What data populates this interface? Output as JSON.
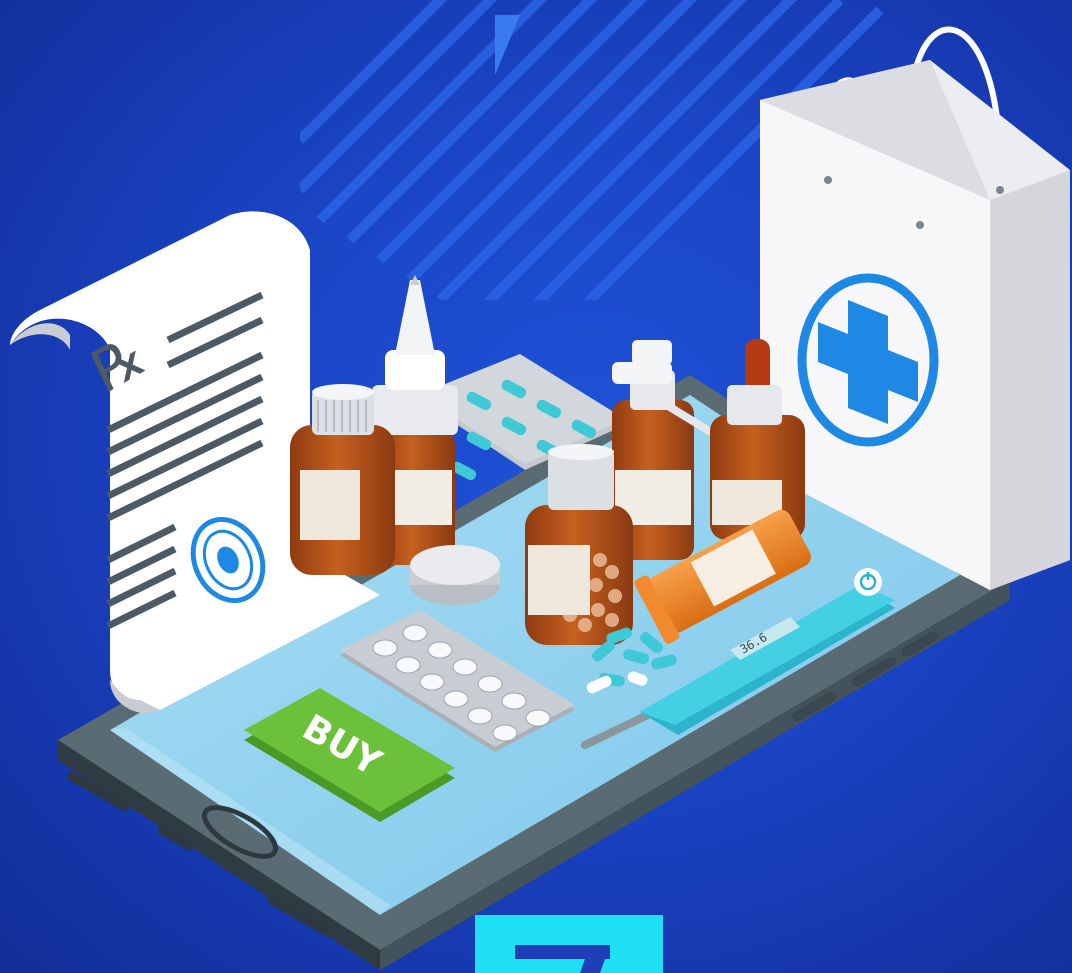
{
  "illustration": {
    "prescription_symbol": "℞",
    "buy_button_label": "BUY",
    "thermometer_reading": "36.6"
  },
  "colors": {
    "background": "#1a44c4",
    "phone_body": "#4f6068",
    "phone_screen": "#8fd0ee",
    "buy_button": "#6cc13a",
    "medical_cross": "#1e88e5",
    "bottle_amber": "#b8541a",
    "accent_cyan": "#1ee0f2"
  }
}
